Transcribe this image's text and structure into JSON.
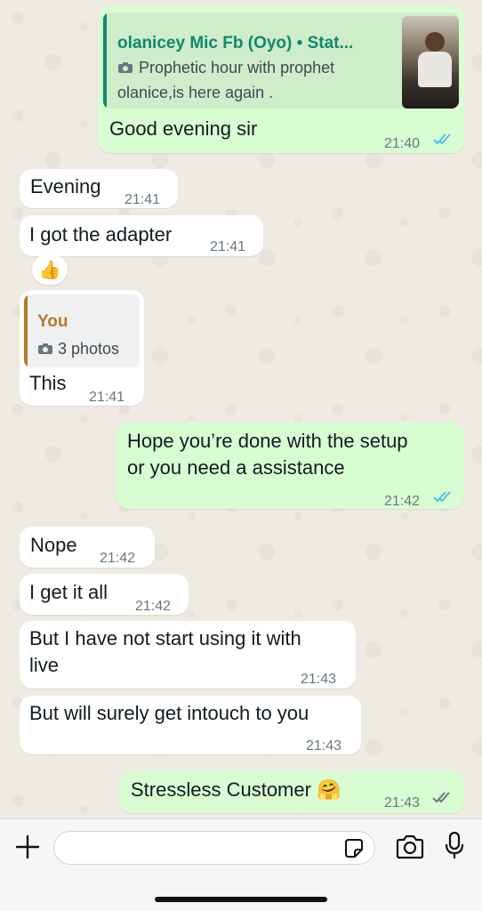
{
  "chat": {
    "status_reply": {
      "author": "olanicey Mic Fb (Oyo) • Stat...",
      "preview_line1": "Prophetic hour with prophet",
      "preview_line2": "olanice,is here again .",
      "text": "Good evening sir",
      "time": "21:40",
      "status": "read"
    },
    "messages": [
      {
        "dir": "in",
        "text": "Evening",
        "time": "21:41"
      },
      {
        "dir": "in",
        "text": "I got the adapter",
        "time": "21:41",
        "reaction": "👍"
      },
      {
        "dir": "in",
        "quote_author": "You",
        "quote_text": "3 photos",
        "text": "This",
        "time": "21:41"
      },
      {
        "dir": "out",
        "line1": "Hope you’re done with the setup",
        "line2": "or you need a assistance",
        "time": "21:42",
        "status": "read"
      },
      {
        "dir": "in",
        "text": "Nope",
        "time": "21:42"
      },
      {
        "dir": "in",
        "text": "I get it all",
        "time": "21:42"
      },
      {
        "dir": "in",
        "line1": "But I have not start using it with",
        "line2": "live",
        "time": "21:43"
      },
      {
        "dir": "in",
        "text": "But will surely get intouch to you",
        "time": "21:43"
      },
      {
        "dir": "out",
        "text": "Stressless Customer 🤗",
        "time": "21:43",
        "status": "delivered"
      }
    ]
  },
  "colors": {
    "background": "#efeae2",
    "incoming": "#ffffff",
    "outgoing": "#d9fdd3",
    "read_ticks": "#53bdeb",
    "delivered_ticks": "#667781",
    "status_author": "#0f8a6b",
    "you_author": "#b27a2c"
  },
  "composer": {
    "input_value": "",
    "icons": [
      "plus-icon",
      "sticker-icon",
      "camera-icon",
      "microphone-icon"
    ]
  }
}
